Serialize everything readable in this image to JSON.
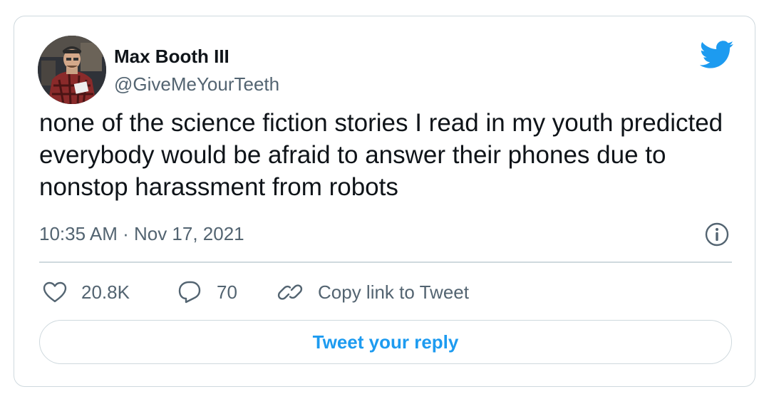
{
  "author": {
    "name": "Max Booth III",
    "handle": "@GiveMeYourTeeth",
    "avatar_icon": "avatar-photo"
  },
  "tweet": {
    "text": "none of the science fiction stories I read in my youth predicted everybody would be afraid to answer their phones due to nonstop harassment from robots",
    "timestamp": "10:35 AM · Nov 17, 2021"
  },
  "actions": {
    "likes": "20.8K",
    "replies": "70",
    "copy_link": "Copy link to Tweet"
  },
  "reply_button": "Tweet your reply",
  "colors": {
    "brand": "#1d9bf0",
    "text": "#0f1419",
    "secondary": "#536471",
    "border": "#cfd9de"
  },
  "icons": [
    "twitter-bird-icon",
    "info-icon",
    "heart-icon",
    "reply-icon",
    "link-icon"
  ]
}
